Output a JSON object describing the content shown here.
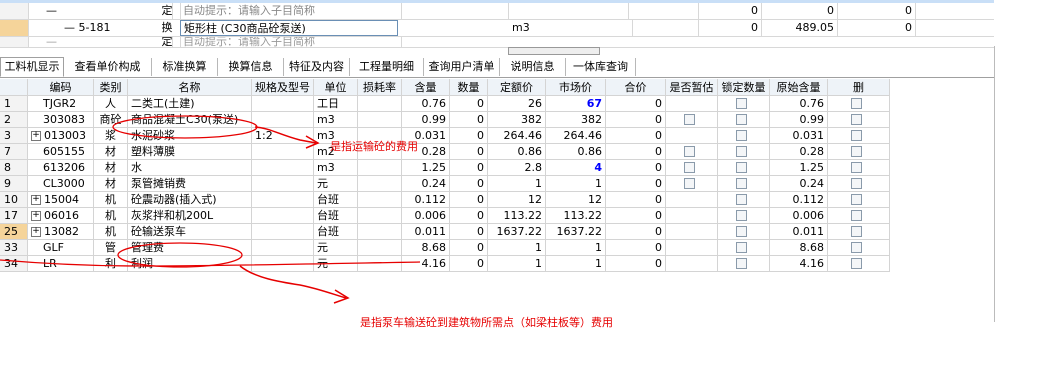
{
  "top_rows": [
    {
      "code": "—",
      "type": "定",
      "name": "自动提示：请输入子目简称",
      "unit": "",
      "qty": "0",
      "price": "0",
      "total": "0"
    },
    {
      "code": "— 5-181",
      "type": "换",
      "name": "矩形柱 (C30商品砼泵送)",
      "unit": "m3",
      "qty": "0",
      "price": "489.05",
      "total": "0"
    },
    {
      "code": "—",
      "type": "定",
      "name": "自动提示：请输入子目简称",
      "unit": "",
      "qty": "0",
      "price": "0",
      "total": "0"
    }
  ],
  "tabs": [
    "工料机显示",
    "查看单价构成",
    "标准换算",
    "换算信息",
    "特征及内容",
    "工程量明细",
    "查询用户清单",
    "说明信息",
    "一体库查询"
  ],
  "columns": [
    "编码",
    "类别",
    "名称",
    "规格及型号",
    "单位",
    "损耗率",
    "含量",
    "数量",
    "定额价",
    "市场价",
    "合价",
    "是否暂估",
    "锁定数量",
    "原始含量",
    "删"
  ],
  "rows": [
    {
      "no": "1",
      "expand": false,
      "code": "TJGR2",
      "type": "人",
      "name": "二类工(土建)",
      "spec": "",
      "unit": "工日",
      "loss": "",
      "content": "0.76",
      "qty": "0",
      "quota": "26",
      "market": "67",
      "market_blue": true,
      "total": "0",
      "est": false,
      "lock": true,
      "orig": "0.76"
    },
    {
      "no": "2",
      "expand": false,
      "code": "303083",
      "type": "商砼",
      "name": "商品混凝土C30(泵送)",
      "spec": "",
      "unit": "m3",
      "loss": "",
      "content": "0.99",
      "qty": "0",
      "quota": "382",
      "market": "382",
      "market_blue": false,
      "total": "0",
      "est": true,
      "lock": true,
      "orig": "0.99"
    },
    {
      "no": "3",
      "expand": true,
      "code": "013003",
      "type": "浆",
      "name": "水泥砂浆",
      "spec": "1:2",
      "unit": "m3",
      "loss": "",
      "content": "0.031",
      "qty": "0",
      "quota": "264.46",
      "market": "264.46",
      "market_blue": false,
      "total": "0",
      "est": false,
      "lock": true,
      "orig": "0.031"
    },
    {
      "no": "7",
      "expand": false,
      "code": "605155",
      "type": "材",
      "name": "塑料薄膜",
      "spec": "",
      "unit": "m2",
      "loss": "",
      "content": "0.28",
      "qty": "0",
      "quota": "0.86",
      "market": "0.86",
      "market_blue": false,
      "total": "0",
      "est": true,
      "lock": true,
      "orig": "0.28"
    },
    {
      "no": "8",
      "expand": false,
      "code": "613206",
      "type": "材",
      "name": "水",
      "spec": "",
      "unit": "m3",
      "loss": "",
      "content": "1.25",
      "qty": "0",
      "quota": "2.8",
      "market": "4",
      "market_blue": true,
      "total": "0",
      "est": true,
      "lock": true,
      "orig": "1.25"
    },
    {
      "no": "9",
      "expand": false,
      "code": "CL3000",
      "type": "材",
      "name": "泵管摊销费",
      "spec": "",
      "unit": "元",
      "loss": "",
      "content": "0.24",
      "qty": "0",
      "quota": "1",
      "market": "1",
      "market_blue": false,
      "total": "0",
      "est": true,
      "lock": true,
      "orig": "0.24"
    },
    {
      "no": "10",
      "expand": true,
      "code": "15004",
      "type": "机",
      "name": "砼震动器(插入式)",
      "spec": "",
      "unit": "台班",
      "loss": "",
      "content": "0.112",
      "qty": "0",
      "quota": "12",
      "market": "12",
      "market_blue": false,
      "total": "0",
      "est": false,
      "lock": true,
      "orig": "0.112"
    },
    {
      "no": "17",
      "expand": true,
      "code": "06016",
      "type": "机",
      "name": "灰浆拌和机200L",
      "spec": "",
      "unit": "台班",
      "loss": "",
      "content": "0.006",
      "qty": "0",
      "quota": "113.22",
      "market": "113.22",
      "market_blue": false,
      "total": "0",
      "est": false,
      "lock": true,
      "orig": "0.006"
    },
    {
      "no": "25",
      "expand": true,
      "code": "13082",
      "type": "机",
      "name": "砼输送泵车",
      "spec": "",
      "unit": "台班",
      "loss": "",
      "content": "0.011",
      "qty": "0",
      "quota": "1637.22",
      "market": "1637.22",
      "market_blue": false,
      "total": "0",
      "est": false,
      "lock": true,
      "orig": "0.011"
    },
    {
      "no": "33",
      "expand": false,
      "code": "GLF",
      "type": "管",
      "name": "管理费",
      "spec": "",
      "unit": "元",
      "loss": "",
      "content": "8.68",
      "qty": "0",
      "quota": "1",
      "market": "1",
      "market_blue": false,
      "total": "0",
      "est": false,
      "lock": true,
      "orig": "8.68"
    },
    {
      "no": "34",
      "expand": false,
      "code": "LR",
      "type": "利",
      "name": "利润",
      "spec": "",
      "unit": "元",
      "loss": "",
      "content": "4.16",
      "qty": "0",
      "quota": "1",
      "market": "1",
      "market_blue": false,
      "total": "0",
      "est": false,
      "lock": true,
      "orig": "4.16"
    }
  ],
  "annotations": {
    "note1": "是指运输砼的费用",
    "note2": "是指泵车输送砼到建筑物所需点（如梁柱板等）费用"
  },
  "colors": {
    "annotation": "#e60000",
    "selected_row": "#f5d49a",
    "market_blue": "#0000ff",
    "header_bg": "#eef3f8"
  }
}
